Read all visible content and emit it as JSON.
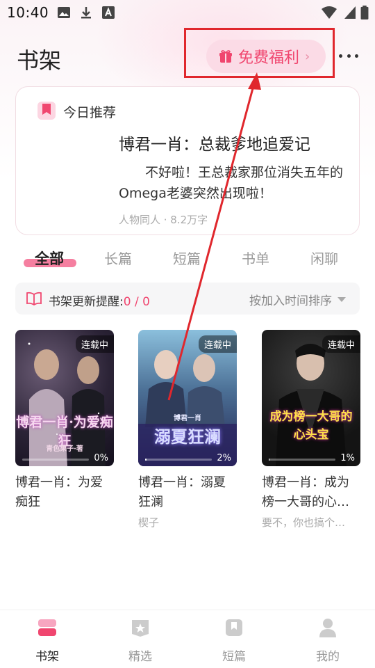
{
  "status_bar": {
    "time": "10:40"
  },
  "header": {
    "title": "书架",
    "welfare_button": "免费福利",
    "welfare_chevron": "›"
  },
  "recommend": {
    "heading": "今日推荐",
    "book_title": "博君一肖：总裁爹地追爱记",
    "description": "不好啦！王总裁家那位消失五年的Omega老婆突然出现啦！",
    "meta": "人物同人 · 8.2万字"
  },
  "tabs": [
    "全部",
    "长篇",
    "短篇",
    "书单",
    "闲聊"
  ],
  "update_bar": {
    "label": "书架更新提醒:",
    "count": "0 / 0",
    "sort_label": "按加入时间排序"
  },
  "books": [
    {
      "title": "博君一肖：为爱痴狂",
      "author": "",
      "badge": "连载中",
      "progress": "0%",
      "progress_value": 0,
      "cover_art": "博君一肖·为爱痴狂",
      "cover_sub": "青色果子·著"
    },
    {
      "title": "博君一肖：溺夏狂澜",
      "author": "楔子",
      "badge": "连载中",
      "progress": "2%",
      "progress_value": 0.02,
      "cover_art": "溺夏狂澜",
      "cover_sub": "博君一肖"
    },
    {
      "title": "博君一肖：成为榜一大哥的心…",
      "author": "要不，你也搞个…",
      "badge": "连载中",
      "progress": "1%",
      "progress_value": 0.01,
      "cover_art": "成为榜一大哥的心头宝",
      "cover_sub": ""
    }
  ],
  "bottom_nav": [
    {
      "label": "书架",
      "icon": "bookshelf-icon",
      "active": true
    },
    {
      "label": "精选",
      "icon": "star-icon",
      "active": false
    },
    {
      "label": "短篇",
      "icon": "book-icon",
      "active": false
    },
    {
      "label": "我的",
      "icon": "user-icon",
      "active": false
    }
  ],
  "colors": {
    "accent": "#f0466f",
    "annotation": "#e0272d",
    "tab_underline": "#f57fa0"
  }
}
